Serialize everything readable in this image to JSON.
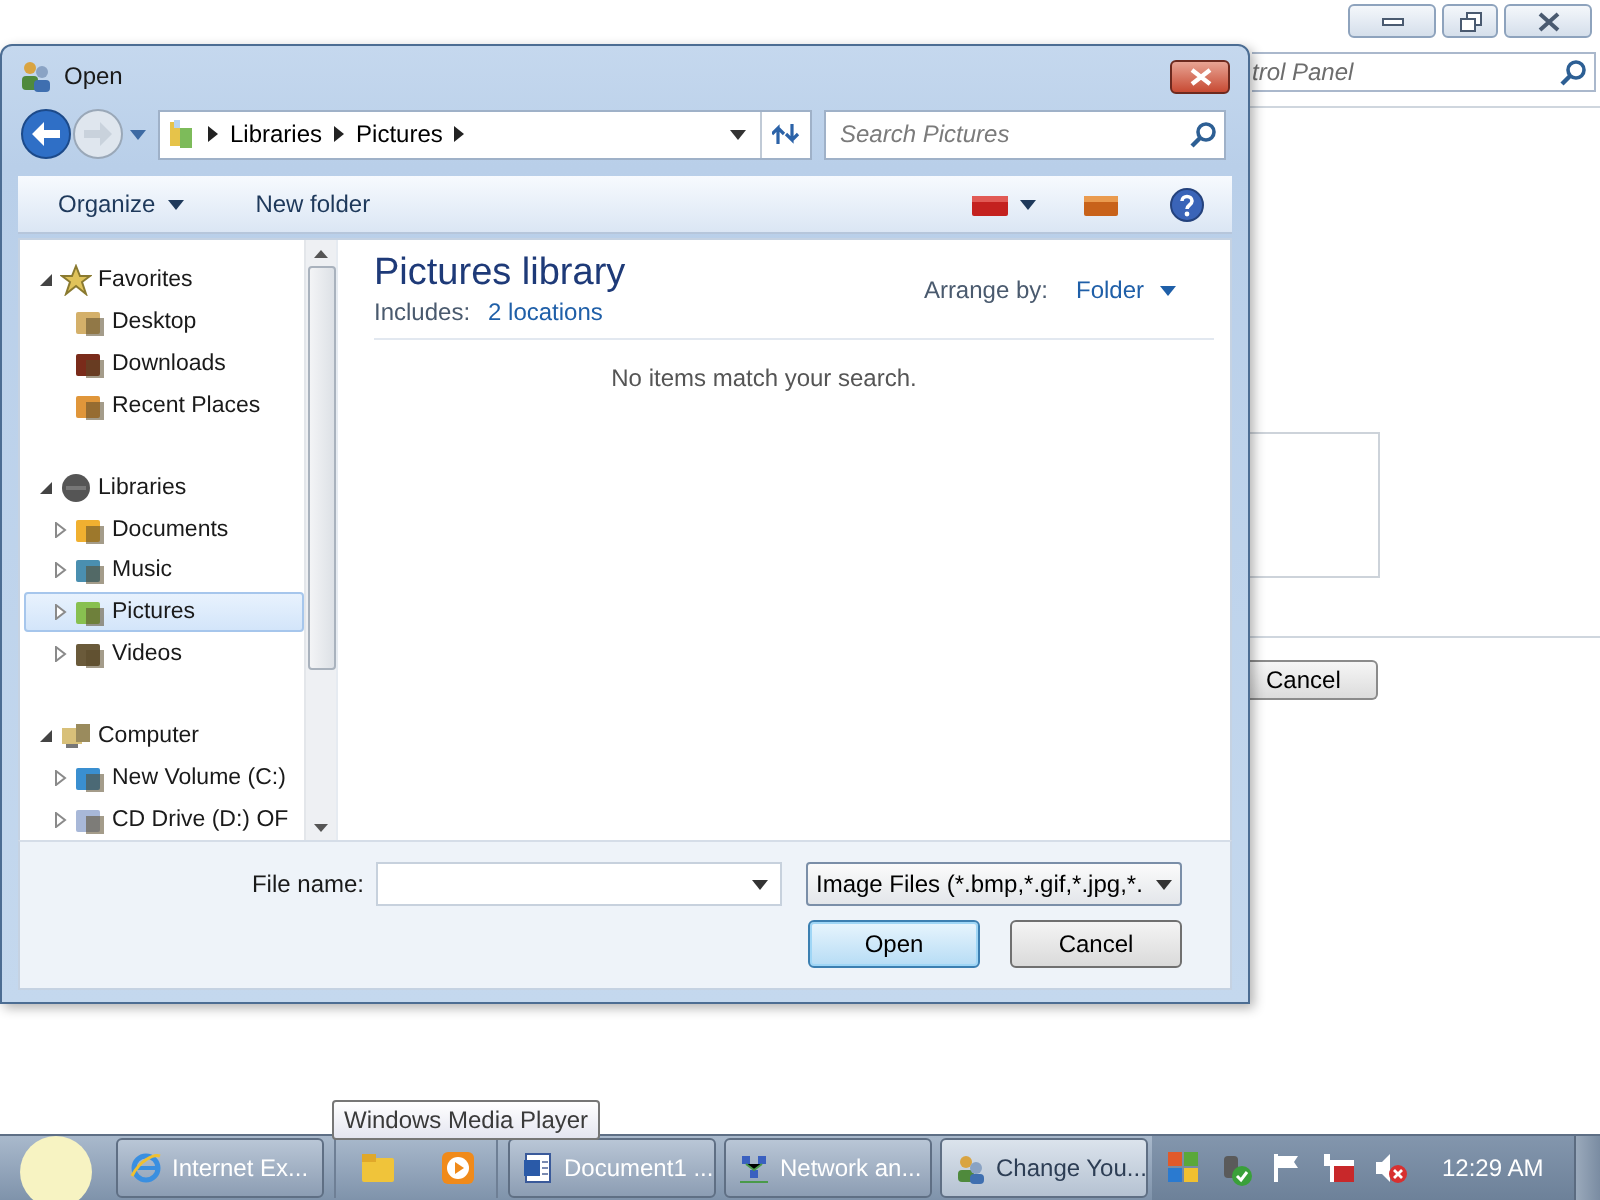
{
  "background_window": {
    "search_placeholder": "trol Panel",
    "buttons": [
      "Cancel"
    ]
  },
  "dialog": {
    "title": "Open",
    "breadcrumb": [
      "Libraries",
      "Pictures"
    ],
    "search_placeholder": "Search Pictures",
    "toolbar": [
      "Organize",
      "New folder"
    ],
    "nav": [
      {
        "label": "Favorites",
        "expanded": true,
        "selected": false,
        "children": [
          {
            "label": "Desktop",
            "selected": false
          },
          {
            "label": "Downloads",
            "selected": false
          },
          {
            "label": "Recent Places",
            "selected": false
          }
        ]
      },
      {
        "label": "Libraries",
        "expanded": true,
        "selected": false,
        "children": [
          {
            "label": "Documents",
            "expanded": false,
            "selected": false
          },
          {
            "label": "Music",
            "expanded": false,
            "selected": false
          },
          {
            "label": "Pictures",
            "expanded": false,
            "selected": true
          },
          {
            "label": "Videos",
            "expanded": false,
            "selected": false
          }
        ]
      },
      {
        "label": "Computer",
        "expanded": true,
        "selected": false,
        "children": [
          {
            "label": "New Volume (C:)",
            "expanded": false,
            "selected": false
          },
          {
            "label": "CD Drive (D:) OF",
            "expanded": false,
            "selected": false
          }
        ]
      }
    ],
    "library_title": "Pictures library",
    "includes_label": "Includes:",
    "includes_link": "2 locations",
    "arrange_label": "Arrange by:",
    "arrange_value": "Folder",
    "empty_message": "No items match your search.",
    "file_name_label": "File name:",
    "file_type": "Image Files (*.bmp,*.gif,*.jpg,*.",
    "buttons": [
      "Open",
      "Cancel"
    ]
  },
  "tooltip": "Windows Media Player",
  "taskbar": {
    "items": [
      {
        "kind": "task",
        "label": "Internet Ex...",
        "selected": false
      },
      {
        "kind": "launcher",
        "selected": false
      },
      {
        "kind": "task",
        "label": "Document1 ...",
        "selected": false
      },
      {
        "kind": "task",
        "label": "Network an...",
        "selected": false
      },
      {
        "kind": "task",
        "label": "Change You...",
        "selected": true
      }
    ],
    "clock": "12:29 AM"
  }
}
